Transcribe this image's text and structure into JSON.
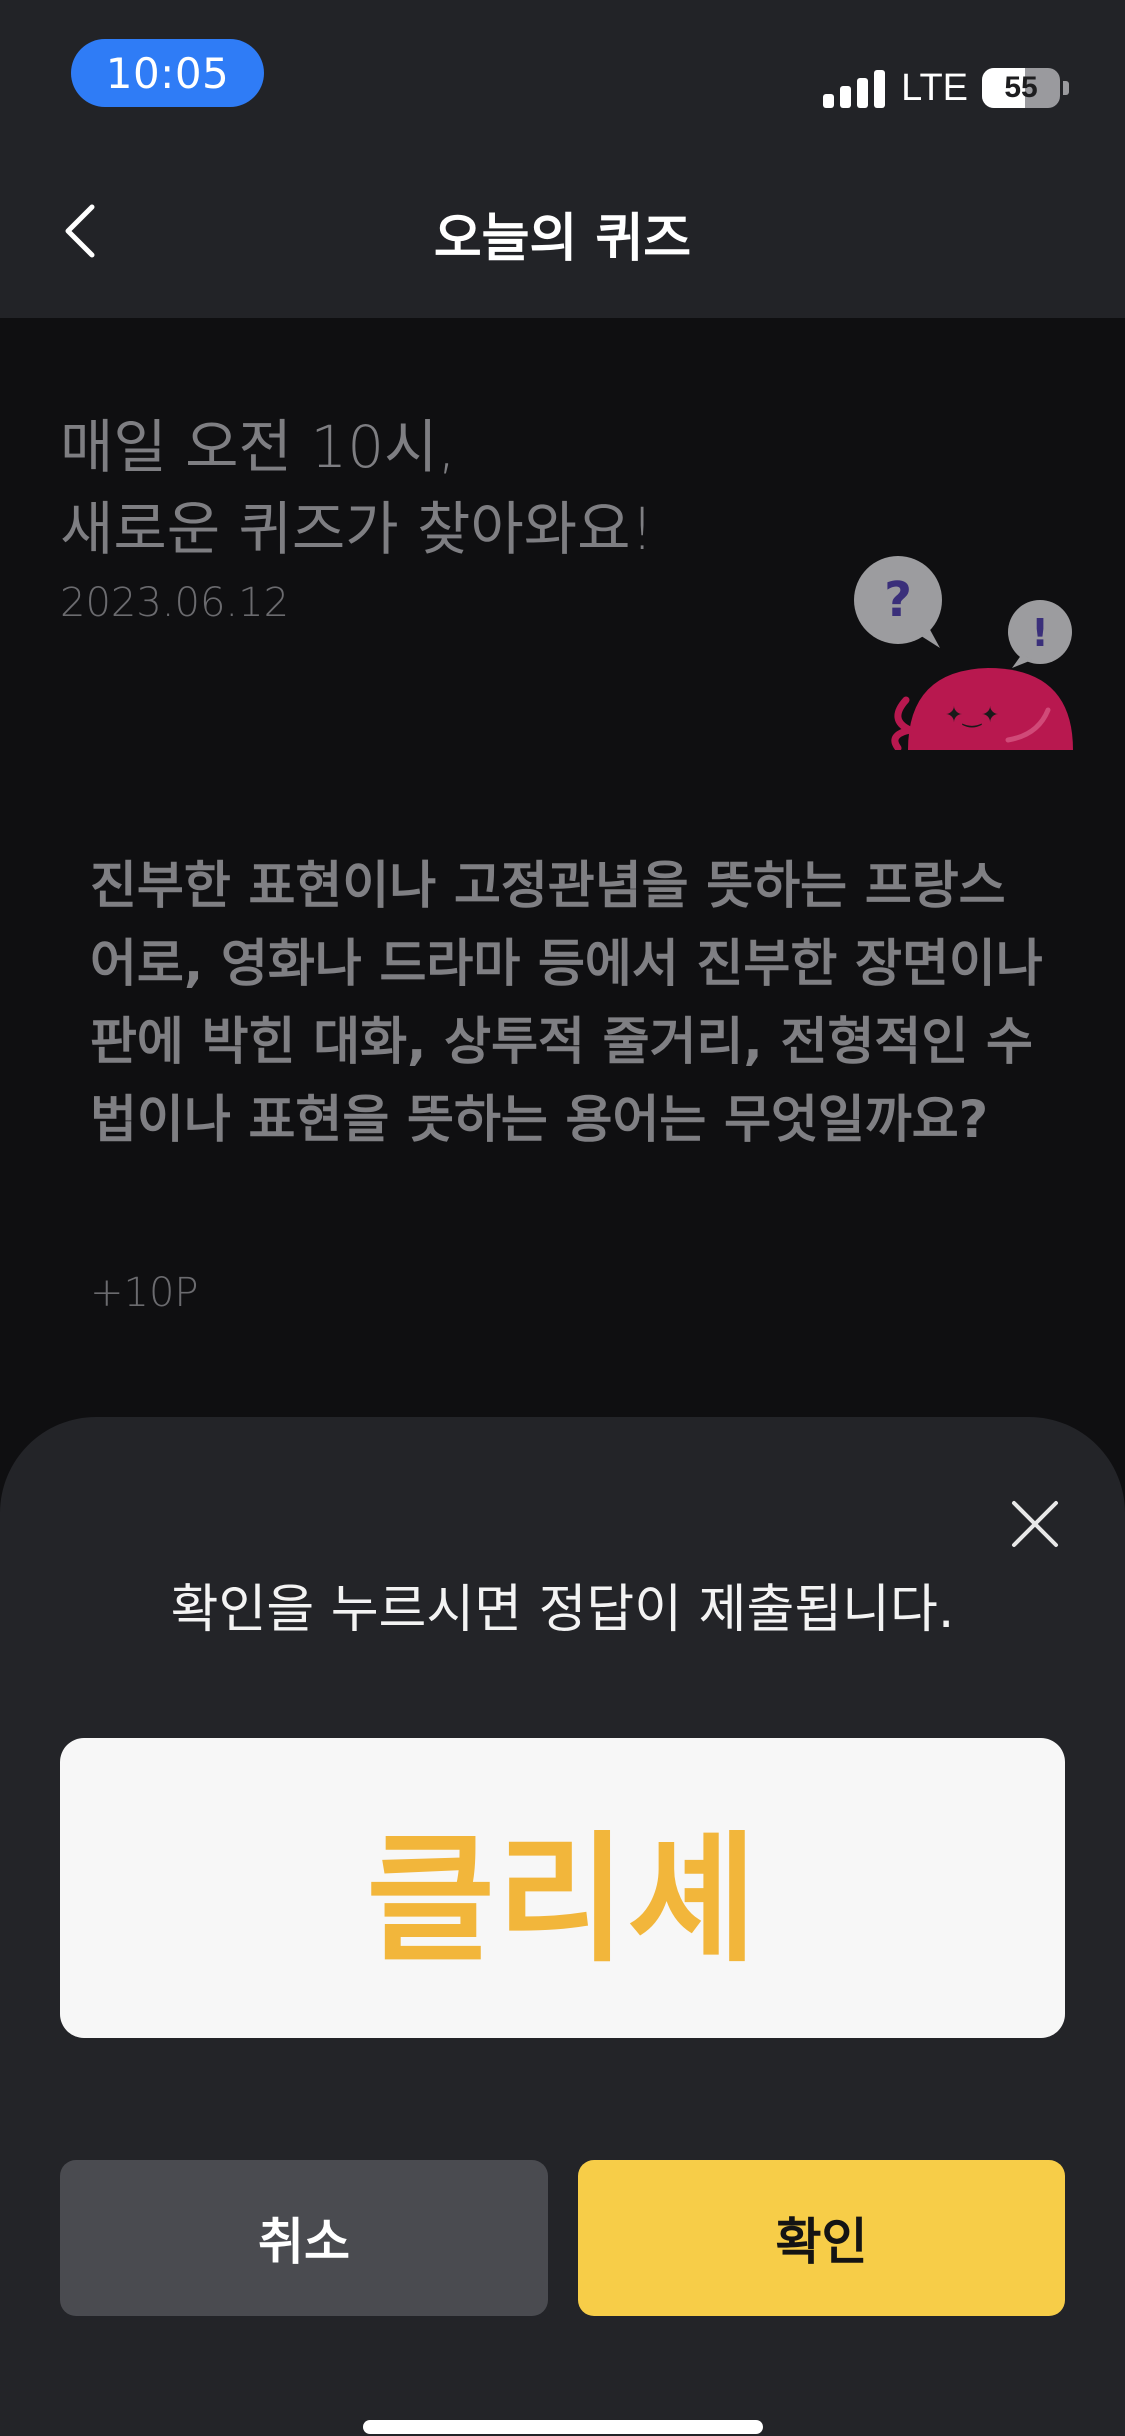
{
  "status_bar": {
    "time": "10:05",
    "network": "LTE",
    "battery": "55",
    "battery_level": 0.55
  },
  "header": {
    "title": "오늘의 퀴즈",
    "back_icon": "chevron-left-icon"
  },
  "intro": {
    "line1": "매일 오전 10시,",
    "line2": "새로운 퀴즈가 찾아와요!",
    "date": "2023.06.12",
    "mascot_icon": "quiz-mascot-icon"
  },
  "quiz": {
    "question": "진부한 표현이나 고정관념을 뜻하는 프랑스어로, 영화나 드라마 등에서 진부한 장면이나 판에 박힌 대화, 상투적 줄거리, 전형적인 수법이나 표현을 뜻하는 용어는 무엇일까요?",
    "points": "+10P"
  },
  "sheet": {
    "message": "확인을 누르시면 정답이 제출됩니다.",
    "answer": "클리셰",
    "cancel_label": "취소",
    "confirm_label": "확인",
    "close_icon": "close-icon"
  },
  "colors": {
    "accent_yellow": "#f7cd48",
    "answer_text": "#f2b63b",
    "time_pill": "#2f7cf6",
    "mascot": "#b8184f"
  }
}
